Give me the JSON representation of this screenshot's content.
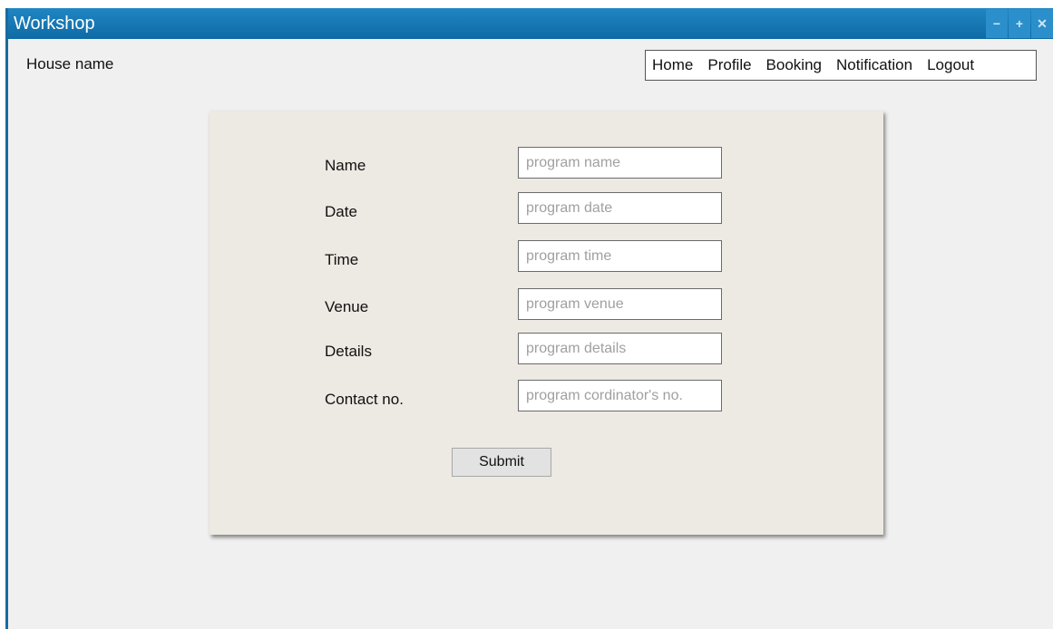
{
  "window": {
    "title": "Workshop",
    "controls": {
      "minimize": "−",
      "maximize": "+",
      "close": "✕"
    }
  },
  "header": {
    "house_name": "House name"
  },
  "nav": {
    "items": [
      {
        "label": "Home"
      },
      {
        "label": "Profile"
      },
      {
        "label": "Booking"
      },
      {
        "label": "Notification"
      },
      {
        "label": "Logout"
      }
    ]
  },
  "form": {
    "fields": [
      {
        "label": "Name",
        "placeholder": "program name"
      },
      {
        "label": "Date",
        "placeholder": "program date"
      },
      {
        "label": "Time",
        "placeholder": "program time"
      },
      {
        "label": "Venue",
        "placeholder": "program venue"
      },
      {
        "label": "Details",
        "placeholder": "program details"
      },
      {
        "label": "Contact no.",
        "placeholder": "program cordinator's no."
      }
    ],
    "submit_label": "Submit"
  }
}
